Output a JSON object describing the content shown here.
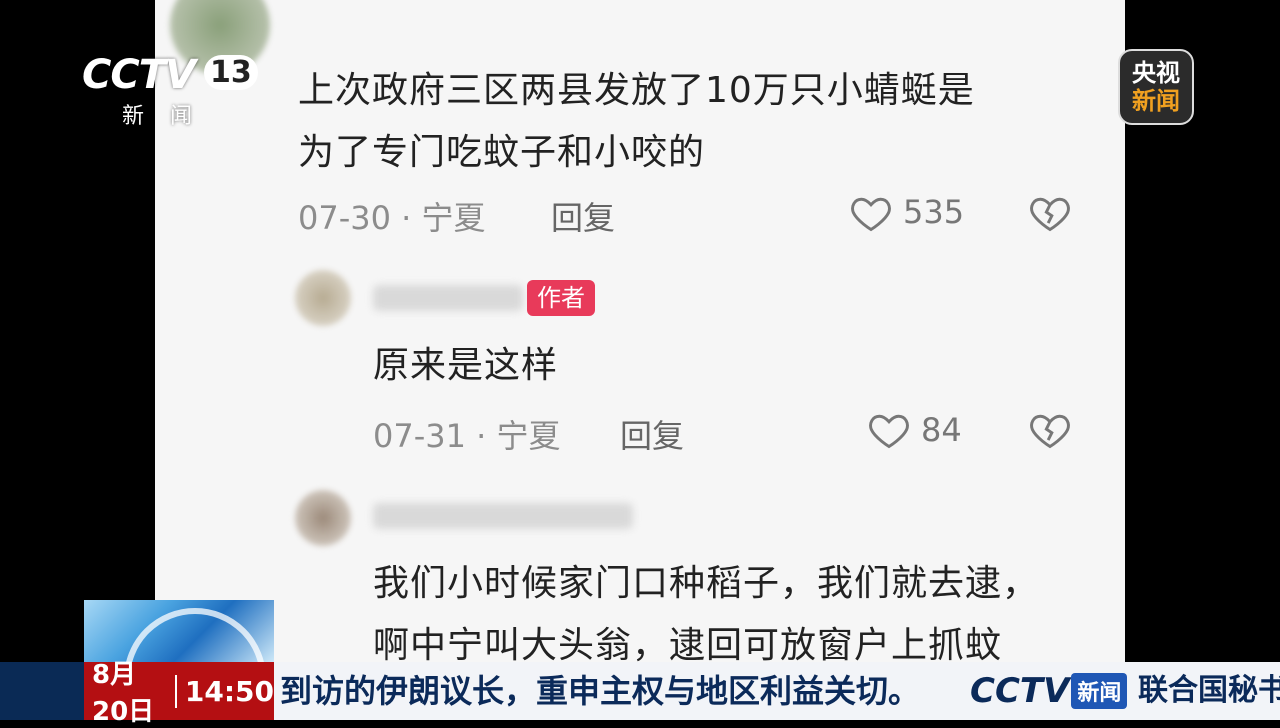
{
  "broadcast": {
    "channel_logo_text": "CCTV",
    "channel_number": "13",
    "channel_sub": "新闻",
    "watermark_top": "央视",
    "watermark_bottom": "新闻"
  },
  "comments": [
    {
      "text_line1": "上次政府三区两县发放了10万只小蜻蜓是",
      "text_line2": "为了专门吃蚊子和小咬的",
      "date": "07-30",
      "location": "宁夏",
      "reply_label": "回复",
      "likes": "535"
    },
    {
      "badge": "作者",
      "text_line1": "原来是这样",
      "date": "07-31",
      "location": "宁夏",
      "reply_label": "回复",
      "likes": "84"
    },
    {
      "text_line1": "我们小时候家门口种稻子，我们就去逮，",
      "text_line2": "啊中宁叫大头翁，逮回可放窗户上抓蚊"
    }
  ],
  "ticker": {
    "date": "8月20日",
    "time": "14:50",
    "headline": "到访的伊朗议长，重申主权与地区利益关切。",
    "logo_text": "CCTV",
    "logo_badge": "新闻",
    "next_headline": "联合国秘书"
  },
  "colors": {
    "badge": "#e83a5a",
    "ticker_bg": "#0a2a55",
    "date_box": "#b40f12"
  },
  "icons": [
    "heart-icon",
    "dislike-heart-icon"
  ]
}
